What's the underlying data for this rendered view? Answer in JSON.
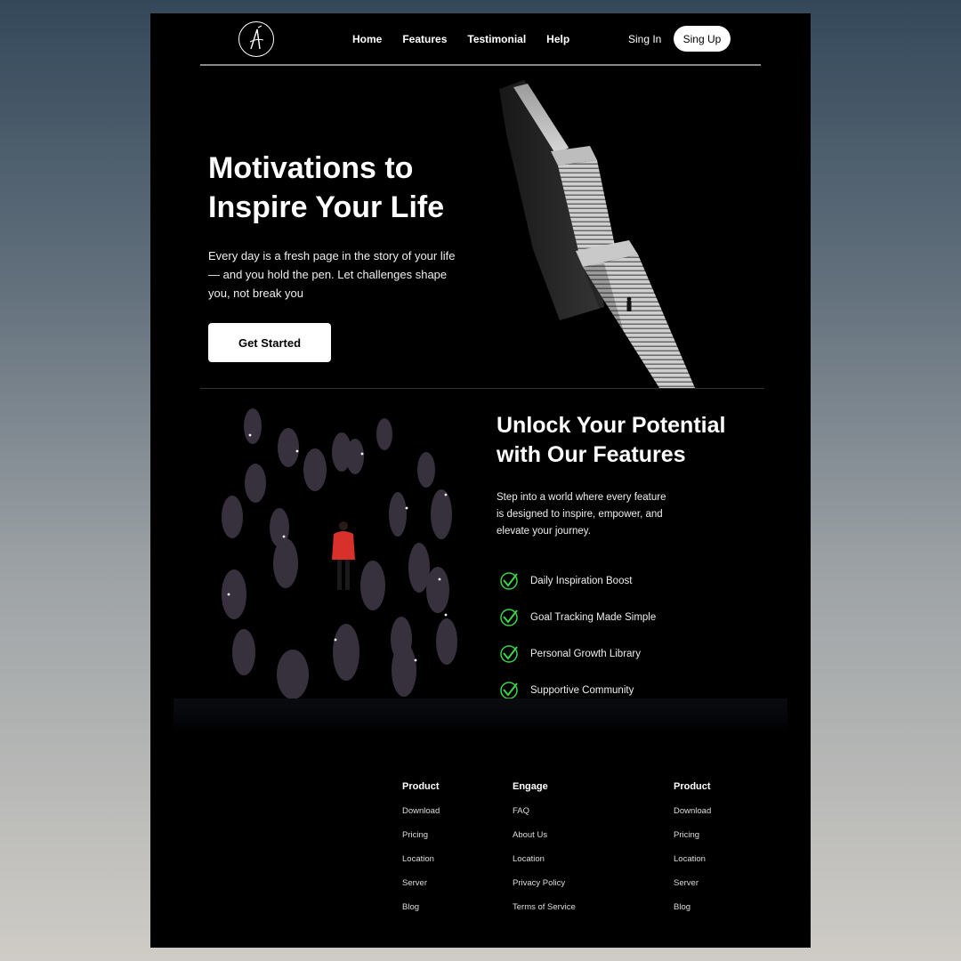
{
  "nav": {
    "links": [
      "Home",
      "Features",
      "Testimonial",
      "Help"
    ],
    "signin": "Sing In",
    "signup": "Sing Up"
  },
  "hero": {
    "title": "Motivations to Inspire Your Life",
    "text": "Every day is a fresh page in the story of your life — and you hold the pen. Let challenges shape you, not break you",
    "cta": "Get Started"
  },
  "features": {
    "title": "Unlock Your Potential with Our Features",
    "text": "Step into a world where every feature is designed to inspire, empower, and elevate your journey.",
    "items": [
      "Daily Inspiration Boost",
      "Goal Tracking Made Simple",
      "Personal Growth Library",
      "Supportive Community"
    ]
  },
  "footer": {
    "columns": [
      {
        "title": "Product",
        "links": [
          "Download",
          "Pricing",
          "Location",
          "Server",
          "Blog"
        ]
      },
      {
        "title": "Engage",
        "links": [
          "FAQ",
          "About Us",
          "Location",
          "Privacy Policy",
          "Terms of Service"
        ]
      },
      {
        "title": "Product",
        "links": [
          "Download",
          "Pricing",
          "Location",
          "Server",
          "Blog"
        ]
      }
    ]
  },
  "colors": {
    "accent_check": "#3dd34a",
    "highlight_person": "#d8302a",
    "page_bg": "#000000"
  },
  "icons": [
    "logo-icon",
    "stairs-image",
    "crowd-image",
    "check-icon"
  ]
}
